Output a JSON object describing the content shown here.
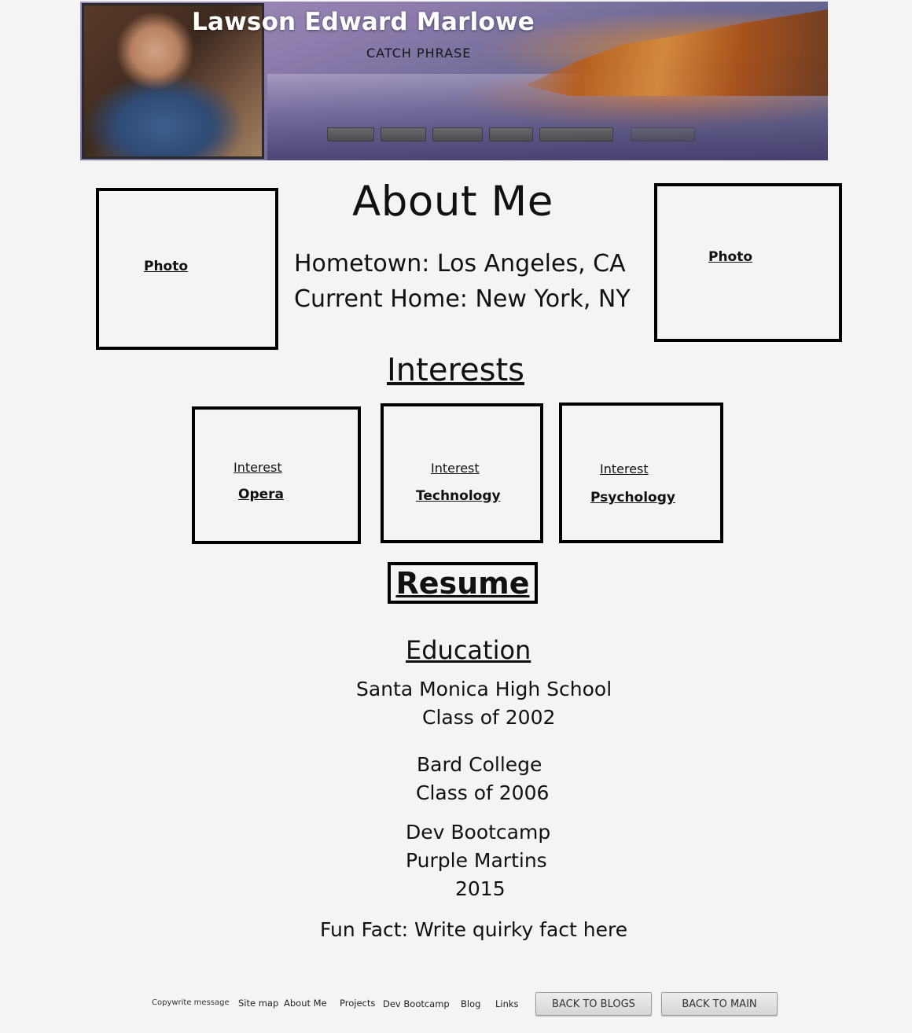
{
  "header": {
    "name": "Lawson Edward Marlowe",
    "catch_phrase": "CATCH PHRASE",
    "nav_items": [
      "",
      "",
      "",
      "",
      "",
      ""
    ]
  },
  "about": {
    "title": "About Me",
    "photo_left_label": "Photo",
    "photo_right_label": "Photo",
    "hometown": "Hometown: Los Angeles, CA",
    "current_home": "Current Home: New York, NY"
  },
  "interests": {
    "title": "Interests",
    "items": [
      {
        "caption": "Interest",
        "name": "Opera "
      },
      {
        "caption": "Interest",
        "name": "Technology"
      },
      {
        "caption": "Interest",
        "name": "Psychology"
      }
    ]
  },
  "resume": {
    "label": "Resume"
  },
  "education": {
    "title": "Education",
    "entries": [
      {
        "lines": [
          "Santa Monica High School",
          "Class of 2002"
        ]
      },
      {
        "lines": [
          "Bard College",
          "Class of 2006"
        ]
      },
      {
        "lines": [
          "Dev Bootcamp",
          "Purple Martins",
          "2015"
        ]
      }
    ],
    "fun_fact": "Fun Fact: Write quirky fact here"
  },
  "footer": {
    "copyright": "Copywrite message",
    "links": [
      "Site map",
      "About Me",
      "Projects",
      "Dev Bootcamp",
      "Blog",
      "Links"
    ],
    "back_to_blogs": "BACK TO BLOGS",
    "back_to_main": "BACK TO MAIN"
  }
}
